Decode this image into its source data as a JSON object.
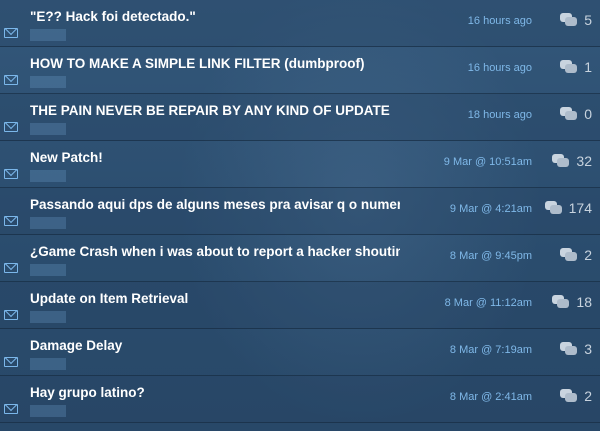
{
  "threads": [
    {
      "title": "\"E?? Hack foi detectado.\"",
      "date": "16 hours ago",
      "replies": "5"
    },
    {
      "title": "HOW TO MAKE A SIMPLE LINK FILTER (dumbproof)",
      "date": "16 hours ago",
      "replies": "1"
    },
    {
      "title": "THE PAIN NEVER BE REPAIR BY ANY KIND OF UPDATE",
      "date": "18 hours ago",
      "replies": "0"
    },
    {
      "title": "New Patch!",
      "date": "9 Mar @ 10:51am",
      "replies": "32"
    },
    {
      "title": "Passando aqui dps de alguns meses pra avisar q o numero ...",
      "date": "9 Mar @ 4:21am",
      "replies": "174"
    },
    {
      "title": "¿Game Crash when i was about to report a hacker shouting ...",
      "date": "8 Mar @ 9:45pm",
      "replies": "2"
    },
    {
      "title": "Update on Item Retrieval",
      "date": "8 Mar @ 11:12am",
      "replies": "18"
    },
    {
      "title": "Damage Delay",
      "date": "8 Mar @ 7:19am",
      "replies": "3"
    },
    {
      "title": "Hay grupo latino?",
      "date": "8 Mar @ 2:41am",
      "replies": "2"
    }
  ],
  "icons": {
    "thread": "mail-icon",
    "replies": "speech-bubbles-icon"
  },
  "colors": {
    "accent": "#7fb8e8",
    "title": "#ffffff",
    "background": "#2c4e6e"
  }
}
